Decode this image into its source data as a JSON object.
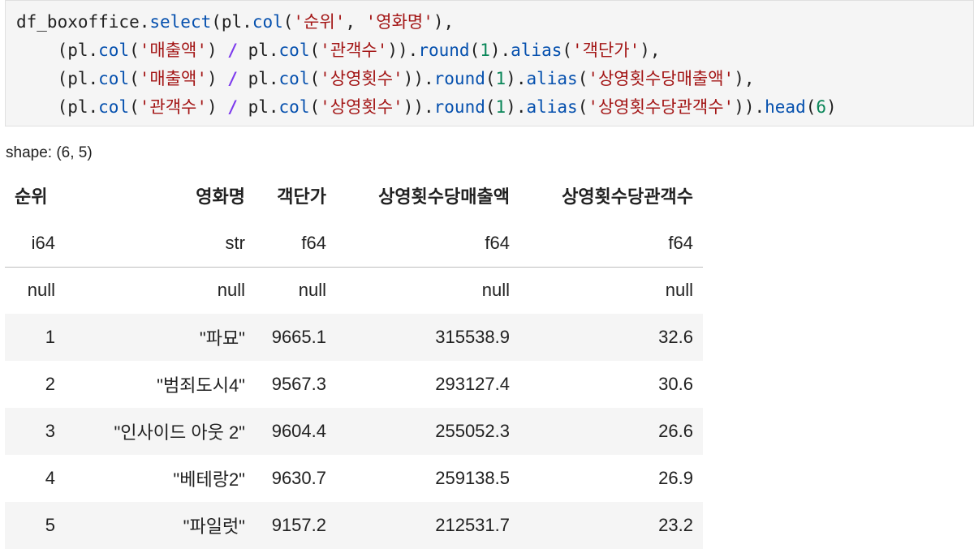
{
  "code": {
    "line1": {
      "a": "df_boxoffice.",
      "b": "select",
      "c": "(pl.",
      "d": "col",
      "e": "(",
      "f": "'순위'",
      "g": ", ",
      "h": "'영화명'",
      "i": "),"
    },
    "line2": {
      "a": "    (pl.",
      "b": "col",
      "c": "(",
      "d": "'매출액'",
      "e": ") ",
      "f": "/",
      "g": " pl.",
      "h": "col",
      "i": "(",
      "j": "'관객수'",
      "k": ")).",
      "l": "round",
      "m": "(",
      "n": "1",
      "o": ").",
      "p": "alias",
      "q": "(",
      "r": "'객단가'",
      "s": "),"
    },
    "line3": {
      "a": "    (pl.",
      "b": "col",
      "c": "(",
      "d": "'매출액'",
      "e": ") ",
      "f": "/",
      "g": " pl.",
      "h": "col",
      "i": "(",
      "j": "'상영횟수'",
      "k": ")).",
      "l": "round",
      "m": "(",
      "n": "1",
      "o": ").",
      "p": "alias",
      "q": "(",
      "r": "'상영횟수당매출액'",
      "s": "),"
    },
    "line4": {
      "a": "    (pl.",
      "b": "col",
      "c": "(",
      "d": "'관객수'",
      "e": ") ",
      "f": "/",
      "g": " pl.",
      "h": "col",
      "i": "(",
      "j": "'상영횟수'",
      "k": ")).",
      "l": "round",
      "m": "(",
      "n": "1",
      "o": ").",
      "p": "alias",
      "q": "(",
      "r": "'상영횟수당관객수'",
      "s": ")).",
      "t": "head",
      "u": "(",
      "v": "6",
      "w": ")"
    }
  },
  "shape": "shape: (6, 5)",
  "table": {
    "headers": [
      "순위",
      "영화명",
      "객단가",
      "상영횟수당매출액",
      "상영횟수당관객수"
    ],
    "dtypes": [
      "i64",
      "str",
      "f64",
      "f64",
      "f64"
    ],
    "nulls": [
      "null",
      "null",
      "null",
      "null",
      "null"
    ],
    "rows": [
      [
        "1",
        "\"파묘\"",
        "9665.1",
        "315538.9",
        "32.6"
      ],
      [
        "2",
        "\"범죄도시4\"",
        "9567.3",
        "293127.4",
        "30.6"
      ],
      [
        "3",
        "\"인사이드 아웃 2\"",
        "9604.4",
        "255052.3",
        "26.6"
      ],
      [
        "4",
        "\"베테랑2\"",
        "9630.7",
        "259138.5",
        "26.9"
      ],
      [
        "5",
        "\"파일럿\"",
        "9157.2",
        "212531.7",
        "23.2"
      ]
    ]
  },
  "colors": {
    "function": "#0550ae",
    "string": "#a31515",
    "number": "#098658",
    "operator": "#7c3aed",
    "cell_bg": "#f5f5f5"
  }
}
